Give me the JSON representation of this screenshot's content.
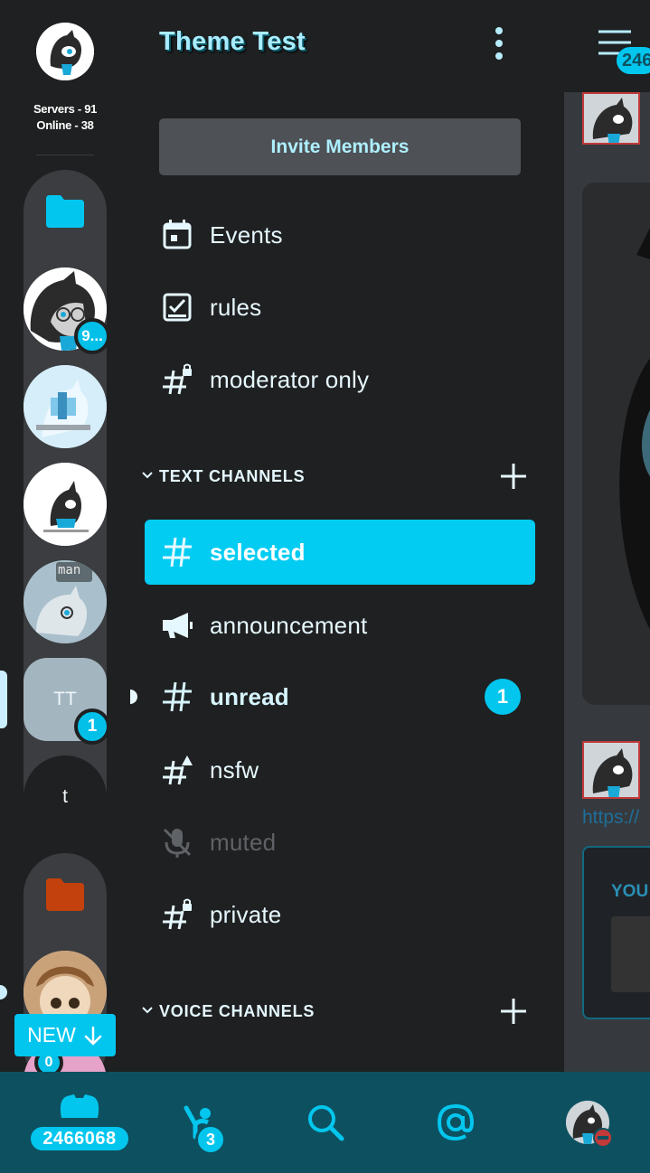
{
  "rail": {
    "stats_servers": "Servers - 91",
    "stats_online": "Online - 38",
    "servers": [
      {
        "type": "folder",
        "color": "#03c6ee"
      },
      {
        "type": "avatar",
        "badge": "9..."
      },
      {
        "type": "avatar"
      },
      {
        "type": "avatar"
      },
      {
        "type": "avatar",
        "text": "man"
      },
      {
        "type": "text",
        "label": "TT",
        "badge": "1"
      },
      {
        "type": "text",
        "label": "t"
      },
      {
        "type": "folder",
        "color": "#c2410c"
      },
      {
        "type": "avatar",
        "badge": "0"
      }
    ],
    "new_button": "NEW"
  },
  "header": {
    "title": "Theme Test",
    "more_icon": "kebab-icon",
    "menu_badge": "246"
  },
  "invite_label": "Invite Members",
  "top_channels": [
    {
      "icon": "calendar-icon",
      "label": "Events"
    },
    {
      "icon": "rules-icon",
      "label": "rules"
    },
    {
      "icon": "locked-hash-icon",
      "label": "moderator only"
    }
  ],
  "text_category": {
    "label": "TEXT CHANNELS"
  },
  "text_channels": [
    {
      "icon": "hash-icon",
      "label": "selected",
      "state": "selected"
    },
    {
      "icon": "megaphone-icon",
      "label": "announcement",
      "state": "normal"
    },
    {
      "icon": "hash-icon",
      "label": "unread",
      "state": "unread",
      "count": "1"
    },
    {
      "icon": "nsfw-hash-icon",
      "label": "nsfw",
      "state": "normal"
    },
    {
      "icon": "mic-off-icon",
      "label": "muted",
      "state": "muted"
    },
    {
      "icon": "locked-hash-icon",
      "label": "private",
      "state": "normal"
    }
  ],
  "voice_category": {
    "label": "VOICE CHANNELS"
  },
  "peek": {
    "link": "https://",
    "embed_title": "YOU"
  },
  "bottom_nav": {
    "home_count": "2466068",
    "friends_count": "3",
    "items": [
      "home-icon",
      "friends-icon",
      "search-icon",
      "mentions-icon",
      "profile-avatar"
    ]
  },
  "colors": {
    "accent": "#03c6ee",
    "background": "#1f2021",
    "bottom_bar": "#0d5161",
    "invite_bg": "#4e5155"
  }
}
